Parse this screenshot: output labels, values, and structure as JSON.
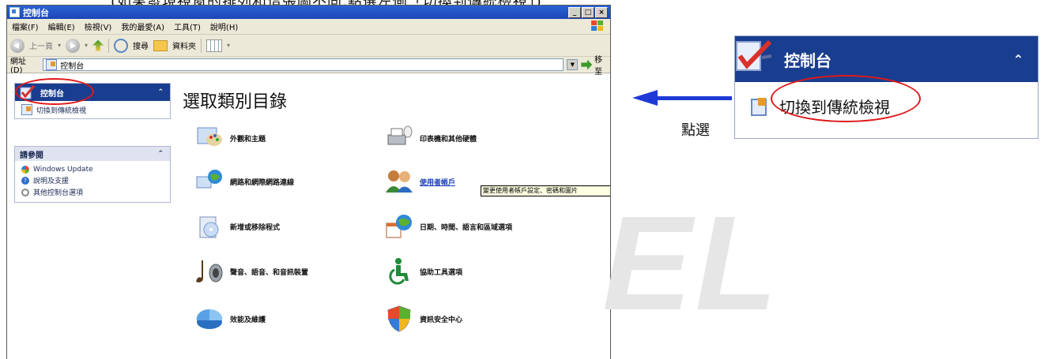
{
  "caption_top": "(如果發現視窗的排列和這張圖不同,點選左側「切換到傳統檢視」)",
  "window": {
    "title": "控制台",
    "controls": [
      "_",
      "□",
      "×"
    ]
  },
  "menu": [
    "檔案(F)",
    "編輯(E)",
    "檢視(V)",
    "我的最愛(A)",
    "工具(T)",
    "說明(H)"
  ],
  "toolbar": {
    "back": "上一頁",
    "search": "搜尋",
    "folders": "資料夾"
  },
  "address": {
    "label": "網址(D)",
    "value": "控制台",
    "go": "移至"
  },
  "left_pane": {
    "panel1_title": "控制台",
    "panel1_link": "切換到傳統檢視",
    "panel2_title": "請參閱",
    "panel2_links": [
      "Windows Update",
      "說明及支援",
      "其他控制台選項"
    ]
  },
  "main": {
    "heading": "選取類別目錄",
    "categories": [
      {
        "label": "外觀和主題",
        "icon": "appearance-icon"
      },
      {
        "label": "印表機和其他硬體",
        "icon": "printer-icon"
      },
      {
        "label": "網路和網際網路連線",
        "icon": "network-icon"
      },
      {
        "label": "使用者帳戶",
        "icon": "users-icon"
      },
      {
        "label": "新增或移除程式",
        "icon": "programs-icon"
      },
      {
        "label": "日期、時間、語言和區域選項",
        "icon": "date-time-icon"
      },
      {
        "label": "聲音、語音、和音訊裝置",
        "icon": "sound-icon"
      },
      {
        "label": "協助工具選項",
        "icon": "accessibility-icon"
      },
      {
        "label": "效能及維護",
        "icon": "performance-icon"
      },
      {
        "label": "資訊安全中心",
        "icon": "security-center-icon"
      }
    ],
    "tooltip": "變更使用者帳戶設定、密碼和圖片"
  },
  "annotation": {
    "click_label": "點選",
    "inset_title": "控制台",
    "inset_link": "切換到傳統檢視"
  },
  "watermark": "EL",
  "colors": {
    "panel_header": "#1a3e8f",
    "arrow": "#1f39d6",
    "highlight_ring": "#e01818"
  }
}
